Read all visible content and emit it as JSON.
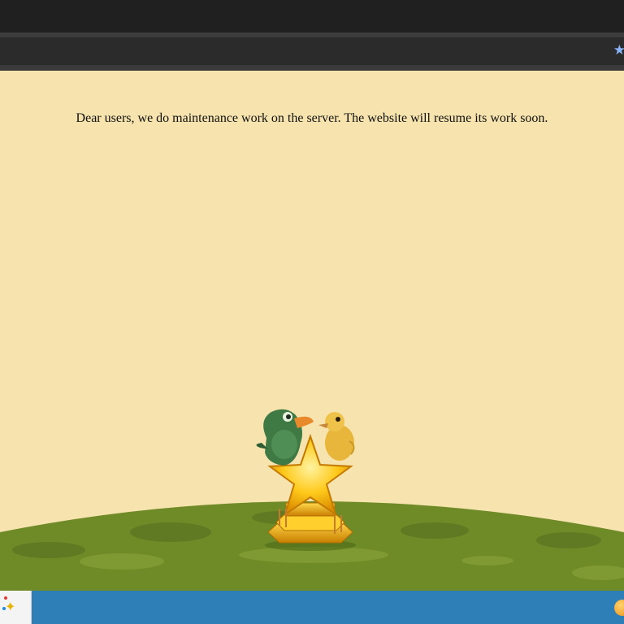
{
  "browser": {
    "bookmark_icon": "star-icon",
    "bookmark_glyph": "★"
  },
  "page": {
    "message": "Dear users, we do maintenance work on the server. The website will resume its work soon."
  },
  "colors": {
    "page_background": "#f6e3ad",
    "ground": "#6f8b28",
    "taskbar": "#2e7fb7",
    "trophy_gold": "#f5b800"
  },
  "taskbar": {
    "start_icon": "sparkle-start-icon",
    "tray_icon": "orange-orb-icon"
  }
}
